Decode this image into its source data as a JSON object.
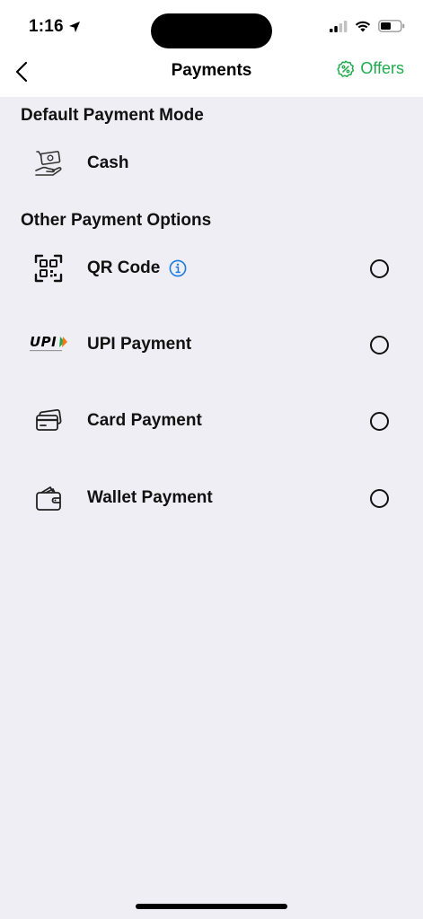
{
  "status_bar": {
    "time": "1:16"
  },
  "header": {
    "title": "Payments",
    "offers_label": "Offers",
    "accent_color": "#1faa4e"
  },
  "default_section": {
    "heading": "Default Payment Mode",
    "items": [
      {
        "label": "Cash",
        "icon": "cash-hand-icon"
      }
    ]
  },
  "other_section": {
    "heading": "Other Payment Options",
    "items": [
      {
        "label": "QR Code",
        "icon": "qr-code-icon",
        "has_info": true,
        "selected": false
      },
      {
        "label": "UPI Payment",
        "icon": "upi-logo",
        "logo_text": "UPI",
        "selected": false
      },
      {
        "label": "Card Payment",
        "icon": "credit-card-icon",
        "selected": false
      },
      {
        "label": "Wallet Payment",
        "icon": "wallet-icon",
        "selected": false
      }
    ]
  }
}
